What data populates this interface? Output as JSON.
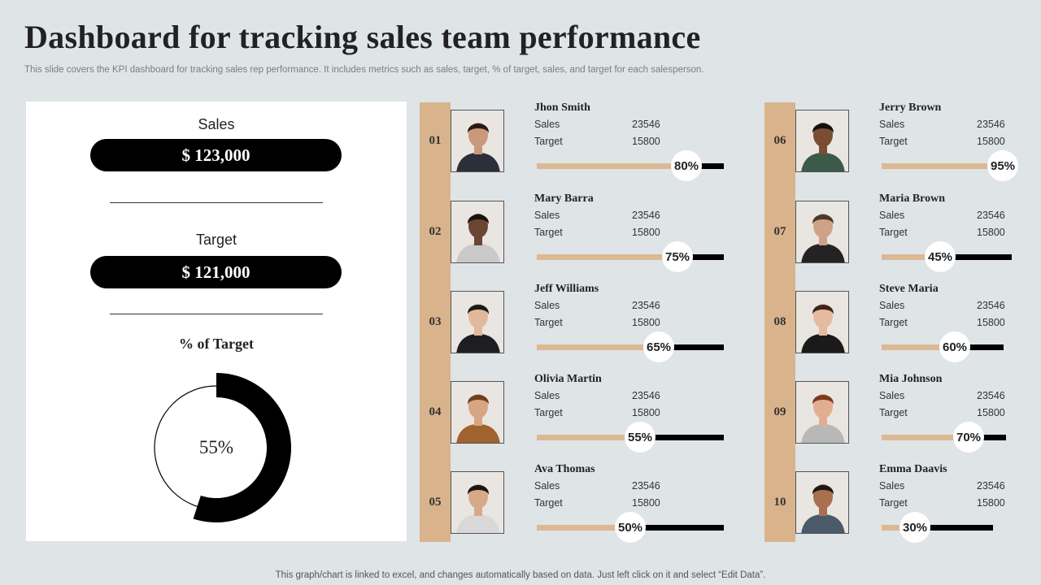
{
  "header": {
    "title": "Dashboard for tracking sales team performance",
    "subtitle": "This slide covers the KPI dashboard for tracking sales rep performance. It includes metrics such as sales, target, % of target,  sales, and target for each salesperson."
  },
  "summary": {
    "sales_label": "Sales",
    "sales_value": "$ 123,000",
    "target_label": "Target",
    "target_value": "$ 121,000",
    "pct_label": "% of Target",
    "pct_text": "55%",
    "pct_value": 55
  },
  "labels": {
    "sales": "Sales",
    "target": "Target"
  },
  "people": [
    {
      "num": "01",
      "name": "Jhon Smith",
      "sales": "23546",
      "target": "15800",
      "pct": 80,
      "pct_text": "80%",
      "skin": "#c99a7a",
      "hair": "#2a1a12",
      "shirt": "#2a2f3a"
    },
    {
      "num": "02",
      "name": "Mary Barra",
      "sales": "23546",
      "target": "15800",
      "pct": 75,
      "pct_text": "75%",
      "skin": "#6b4632",
      "hair": "#1a120d",
      "shirt": "#c9c9c9"
    },
    {
      "num": "03",
      "name": "Jeff Williams",
      "sales": "23546",
      "target": "15800",
      "pct": 65,
      "pct_text": "65%",
      "skin": "#e2b89a",
      "hair": "#1b1b1b",
      "shirt": "#1e1e22"
    },
    {
      "num": "04",
      "name": "Olivia Martin",
      "sales": "23546",
      "target": "15800",
      "pct": 55,
      "pct_text": "55%",
      "skin": "#d8a582",
      "hair": "#6b3f1f",
      "shirt": "#a0622e"
    },
    {
      "num": "05",
      "name": "Ava Thomas",
      "sales": "23546",
      "target": "15800",
      "pct": 50,
      "pct_text": "50%",
      "skin": "#d7a988",
      "hair": "#1c1613",
      "shirt": "#d8d8d8"
    },
    {
      "num": "06",
      "name": "Jerry Brown",
      "sales": "23546",
      "target": "15800",
      "pct": 95,
      "pct_text": "95%",
      "skin": "#7a4d33",
      "hair": "#141010",
      "shirt": "#3c5a4a"
    },
    {
      "num": "07",
      "name": "Maria Brown",
      "sales": "23546",
      "target": "15800",
      "pct": 45,
      "pct_text": "45%",
      "skin": "#cfa288",
      "hair": "#4a3a2c",
      "shirt": "#232323"
    },
    {
      "num": "08",
      "name": "Steve Maria",
      "sales": "23546",
      "target": "15800",
      "pct": 60,
      "pct_text": "60%",
      "skin": "#e4bba0",
      "hair": "#3e2418",
      "shirt": "#1a1a1a"
    },
    {
      "num": "09",
      "name": "Mia Johnson",
      "sales": "23546",
      "target": "15800",
      "pct": 70,
      "pct_text": "70%",
      "skin": "#e1ae92",
      "hair": "#7a3a1e",
      "shirt": "#b8b8b8"
    },
    {
      "num": "10",
      "name": "Emma Daavis",
      "sales": "23546",
      "target": "15800",
      "pct": 30,
      "pct_text": "30%",
      "skin": "#a86f50",
      "hair": "#1d1612",
      "shirt": "#4a5a6a"
    }
  ],
  "footer": "This graph/chart is linked to excel,  and changes automatically based on data. Just left click on it and select “Edit Data”.",
  "colors": {
    "accent": "#d9b38c",
    "bar_fill": "#dcb893",
    "dark": "#000000",
    "background": "#dfe4e7"
  }
}
